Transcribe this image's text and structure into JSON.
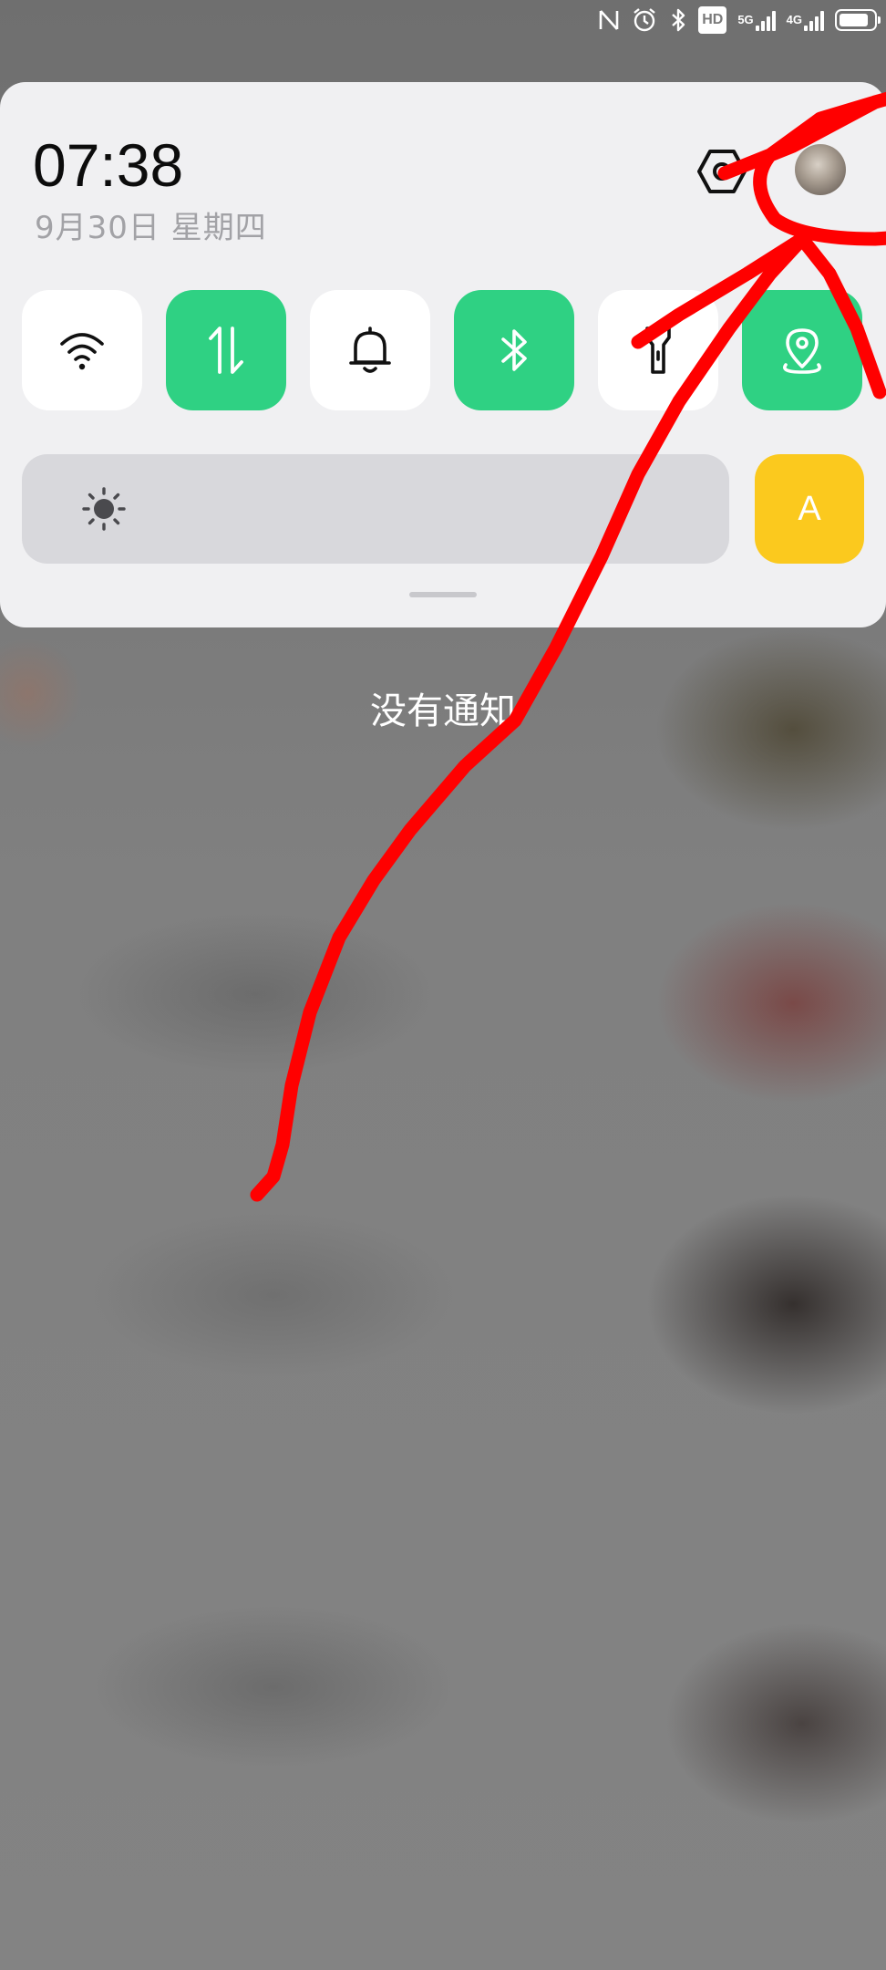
{
  "status_bar": {
    "hd_badge": "HD",
    "sim1_network": "5G",
    "sim2_network": "4G",
    "battery_level": 0.85,
    "icons": [
      "nfc-icon",
      "alarm-icon",
      "bluetooth-icon",
      "hd-voice-icon",
      "signal-5g-icon",
      "signal-4g-icon",
      "battery-icon"
    ]
  },
  "header": {
    "time": "07:38",
    "date": "9月30日  星期四"
  },
  "toggles": [
    {
      "name": "wifi",
      "icon": "wifi-icon",
      "on": false
    },
    {
      "name": "mobile-data",
      "icon": "data-arrows-icon",
      "on": true
    },
    {
      "name": "ringer",
      "icon": "bell-icon",
      "on": false
    },
    {
      "name": "bluetooth",
      "icon": "bluetooth-icon",
      "on": true
    },
    {
      "name": "flashlight",
      "icon": "flashlight-icon",
      "on": false
    },
    {
      "name": "location",
      "icon": "location-pin-icon",
      "on": true
    }
  ],
  "brightness": {
    "icon": "sun-icon",
    "auto_label": "A"
  },
  "notifications": {
    "empty_text": "没有通知"
  },
  "colors": {
    "panel_bg": "#f0f0f2",
    "toggle_on": "#2fd183",
    "toggle_off": "#ffffff",
    "auto_brightness": "#fbc91e",
    "annotation": "#ff0000"
  }
}
